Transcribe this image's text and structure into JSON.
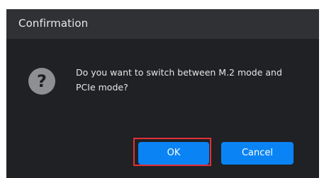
{
  "dialog": {
    "title": "Confirmation",
    "icon": "question-icon",
    "message": "Do you want to switch between M.2 mode and PCIe mode?",
    "buttons": {
      "ok_label": "OK",
      "cancel_label": "Cancel"
    }
  },
  "colors": {
    "dialog_background": "#202124",
    "titlebar_background": "#303134",
    "button_primary": "#0a84f5",
    "highlight_border": "#e0313a"
  }
}
